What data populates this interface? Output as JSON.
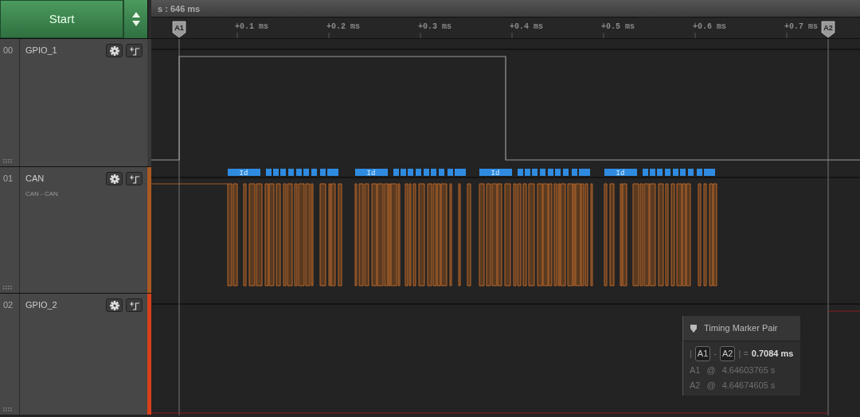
{
  "start_button": {
    "label": "Start"
  },
  "timebar": {
    "label": "s : 646 ms"
  },
  "ruler": {
    "ticks": [
      "+0.1 ms",
      "+0.2 ms",
      "+0.3 ms",
      "+0.4 ms",
      "+0.5 ms",
      "+0.6 ms",
      "+0.7 ms"
    ],
    "markers": [
      {
        "label": "A1"
      },
      {
        "label": "A2"
      }
    ]
  },
  "channels": [
    {
      "number": "00",
      "name": "GPIO_1",
      "kind": "digital",
      "color": "#3a3a3a"
    },
    {
      "number": "01",
      "name": "CAN",
      "subtitle": "CAN - CAN",
      "kind": "can",
      "color": "#a85a22",
      "frames": [
        {
          "label": "Id"
        },
        {
          "label": "Id"
        },
        {
          "label": "Id"
        },
        {
          "label": "Id"
        }
      ]
    },
    {
      "number": "02",
      "name": "GPIO_2",
      "kind": "idle",
      "color": "#d8401c"
    }
  ],
  "marker_panel": {
    "title": "Timing Marker Pair",
    "delta": {
      "open": "|",
      "a": "A1",
      "minus": "-",
      "b": "A2",
      "close": "| =",
      "value": "0.7084 ms"
    },
    "rows": [
      {
        "marker": "A1",
        "at": "@",
        "time": "4.64603765 s"
      },
      {
        "marker": "A2",
        "at": "@",
        "time": "4.64674605 s"
      }
    ]
  }
}
